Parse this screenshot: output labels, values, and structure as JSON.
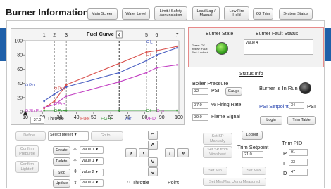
{
  "header": {
    "title": "Burner Information",
    "buttons": [
      {
        "label": "Main Screen"
      },
      {
        "label": "Water Level"
      },
      {
        "label": "Limit / Safety Annunciation"
      },
      {
        "label": "Lead Lag / Manual"
      },
      {
        "label": "Low Fire Hold"
      },
      {
        "label": "O2 Trim"
      },
      {
        "label": "System Status"
      }
    ]
  },
  "curve": {
    "title": "Fuel Curve",
    "throttle_value": "37.0",
    "legend": [
      "Throttle",
      "Fuel",
      "FGR",
      "Air",
      "VFD"
    ],
    "colors": {
      "fuel": "#d9534f",
      "fgr": "#3a9a3a",
      "air": "#4a5fc1",
      "vfd": "#c23fc2"
    }
  },
  "chart_data": {
    "type": "line",
    "xlim": [
      10,
      100
    ],
    "ylim": [
      0,
      100
    ],
    "xticks": [
      10,
      20,
      30,
      40,
      50,
      60,
      70,
      80,
      90,
      100
    ],
    "yticks": [
      0,
      20,
      40,
      60,
      80,
      100
    ],
    "point_labels": [
      "1",
      "2",
      "3",
      "4",
      "5",
      "6",
      "7"
    ],
    "point_x": [
      21,
      27,
      34,
      65,
      81,
      87,
      99
    ],
    "selected_point": "4",
    "series": [
      {
        "name": "Fuel",
        "color": "#d9534f",
        "x": [
          21,
          27,
          34,
          65,
          81,
          87,
          99
        ],
        "y": [
          5,
          15,
          38,
          68,
          84,
          86,
          92
        ]
      },
      {
        "name": "FGR",
        "color": "#3a9a3a",
        "x": [
          21,
          27,
          34,
          65,
          81,
          87,
          99
        ],
        "y": [
          2,
          2,
          2,
          2,
          2,
          2,
          2
        ]
      },
      {
        "name": "Air",
        "color": "#4a5fc1",
        "x": [
          21,
          27,
          34,
          65,
          81,
          87,
          99
        ],
        "y": [
          15,
          25,
          35,
          55,
          72,
          80,
          90
        ]
      },
      {
        "name": "VFD",
        "color": "#c23fc2",
        "x": [
          21,
          27,
          34,
          65,
          81,
          87,
          99
        ],
        "y": [
          6,
          10,
          22,
          42,
          55,
          62,
          66
        ]
      }
    ],
    "markers": [
      {
        "text": "Po",
        "series": "Air",
        "x": 10,
        "y": 38
      },
      {
        "text": "Pre",
        "series": "Fuel",
        "x": 27,
        "y": 33
      },
      {
        "text": "Pre",
        "series": "VFD",
        "x": 27,
        "y": 12
      },
      {
        "text": "Pre",
        "series": "FGR",
        "x": 27,
        "y": 2
      },
      {
        "text": "Sb Po",
        "series": "VFD",
        "x": 10,
        "y": 2
      },
      {
        "text": "L",
        "series": "Air",
        "x": 81,
        "y": 99
      },
      {
        "text": "L",
        "series": "Fuel",
        "x": 81,
        "y": 81
      },
      {
        "text": "L",
        "series": "FGR",
        "x": 81,
        "y": 2
      },
      {
        "text": "In",
        "series": "VFD",
        "x": 87,
        "y": 2
      }
    ]
  },
  "burner": {
    "state_title": "Burner State",
    "state_legend": "Green: OK\nYellow: Fault\nRed: Lockout",
    "fault_title": "Burner Fault Status",
    "fault_value": "value 4"
  },
  "status": {
    "title": "Status Info",
    "boiler_pressure_label": "Boiler Pressure",
    "pressure_value": "32",
    "psi_label": "PSI",
    "gauge_button": "Gauge",
    "firing_rate_value": "37.0",
    "firing_rate_label": "% Firing Rate",
    "flame_value": "39.0",
    "flame_label": "Flame Signal",
    "in_run_label": "Burner Is In Run",
    "setpoint_label": "PSI Setpoint",
    "setpoint_value": "34",
    "setpoint_unit": "PSI",
    "login_button": "Login",
    "trim_table_button": "Trim Table"
  },
  "controls": {
    "define": "Define...",
    "select_preset": "Select preset",
    "goto": "Go to...",
    "confirm_prepurge": "Confirm Prepurge",
    "confirm_lightoff": "Confirm Lightoff",
    "create": "Create",
    "delete": "Delete",
    "stop": "Stop",
    "update": "Update",
    "value_selects": [
      "value 1",
      "value 1",
      "value 2",
      "value 2"
    ],
    "throttle_label": "Throttle",
    "point_label": "Point"
  },
  "setpoints": {
    "set_sp_manually": "Set SP Manually",
    "set_sp_wsheet": "Set SP from Worsheet",
    "logout": "Logout",
    "trim_setpoint_label": "Trim Setpoint",
    "trim_setpoint_value": "21.0",
    "set_min": "Set Min",
    "set_max": "Set Max",
    "set_minmax_measured": "Set Min/Max Using Measured"
  },
  "trim_pid": {
    "title": "Trim PID",
    "p_label": "P",
    "p_value": "91",
    "i_label": "I",
    "i_value": "33",
    "d_label": "D",
    "d_value": "47"
  }
}
